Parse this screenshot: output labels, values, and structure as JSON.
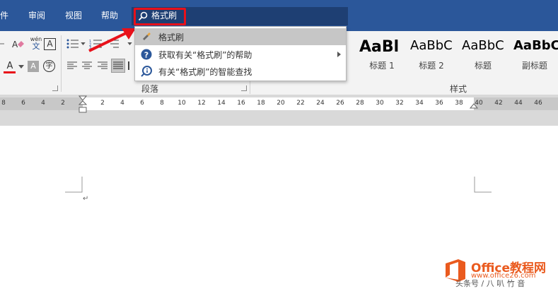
{
  "menu": {
    "file": "件",
    "review": "审阅",
    "view": "视图",
    "help": "帮助"
  },
  "search": {
    "query": "格式刷"
  },
  "dropdown": {
    "items": [
      {
        "label": "格式刷",
        "icon": "format-painter-icon"
      },
      {
        "label": "获取有关“格式刷”的帮助",
        "icon": "help-circle-icon"
      },
      {
        "label": "有关“格式刷”的智能查找",
        "icon": "smart-lookup-icon"
      }
    ]
  },
  "ribbon": {
    "paragraph_group": "段落",
    "styles_group": "样式",
    "phonetic_glyph": "wén",
    "phonetic_char": "文",
    "char_border_glyph": "A",
    "font_color_glyph": "A",
    "char_shading_glyph": "A",
    "enclose_char_glyph": "字"
  },
  "styles": [
    {
      "sample": "AaBl",
      "name": "标题 1"
    },
    {
      "sample": "AaBbC",
      "name": "标题 2"
    },
    {
      "sample": "AaBbC",
      "name": "标题"
    },
    {
      "sample": "AaBbC",
      "name": "副标题"
    }
  ],
  "ruler": {
    "numbers": [
      "8",
      "6",
      "4",
      "2",
      "2",
      "4",
      "6",
      "8",
      "10",
      "12",
      "14",
      "16",
      "18",
      "20",
      "22",
      "24",
      "26",
      "28",
      "30",
      "32",
      "34",
      "36",
      "38",
      "40",
      "42",
      "44",
      "46"
    ]
  },
  "document": {
    "paragraph_mark": "↵"
  },
  "watermark": {
    "brand": "Office教程网",
    "url": "www.office26.com",
    "credit": "头条号 / 八 叭 竹 音"
  },
  "colors": {
    "menubar": "#2b579a",
    "highlight": "#e8111a",
    "font_color_bar": "#e8111a",
    "help_blue": "#2b579a",
    "watermark_orange": "#ea5a1e"
  }
}
